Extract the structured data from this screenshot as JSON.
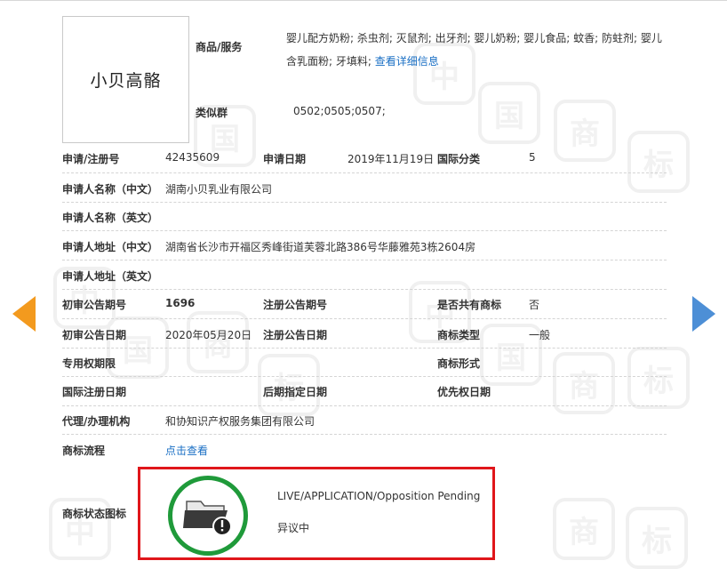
{
  "trademark": {
    "name": "小贝高骼",
    "goods_label": "商品/服务",
    "goods_text": "婴儿配方奶粉; 杀虫剂; 灭鼠剂; 出牙剂; 婴儿奶粉; 婴儿食品; 蚊香; 防蛀剂; 婴儿含乳面粉; 牙填料;",
    "goods_link": "查看详细信息",
    "similar_group_label": "类似群",
    "similar_group_value": "0502;0505;0507;"
  },
  "fields": {
    "reg_no_label": "申请/注册号",
    "reg_no_value": "42435609",
    "apply_date_label": "申请日期",
    "apply_date_value": "2019年11月19日",
    "intl_class_label": "国际分类",
    "intl_class_value": "5",
    "applicant_cn_label": "申请人名称（中文）",
    "applicant_cn_value": "湖南小贝乳业有限公司",
    "applicant_en_label": "申请人名称（英文）",
    "address_cn_label": "申请人地址（中文）",
    "address_cn_value": "湖南省长沙市开福区秀峰街道芙蓉北路386号华藤雅苑3栋2604房",
    "address_en_label": "申请人地址（英文）",
    "prelim_issue_label": "初审公告期号",
    "prelim_issue_value": "1696",
    "reg_issue_label": "注册公告期号",
    "shared_label": "是否共有商标",
    "shared_value": "否",
    "prelim_date_label": "初审公告日期",
    "prelim_date_value": "2020年05月20日",
    "reg_date_label": "注册公告日期",
    "tm_type_label": "商标类型",
    "tm_type_value": "一般",
    "exclusive_label": "专用权期限",
    "tm_form_label": "商标形式",
    "intl_reg_label": "国际注册日期",
    "later_date_label": "后期指定日期",
    "priority_label": "优先权日期",
    "agent_label": "代理/办理机构",
    "agent_value": "和协知识产权服务集团有限公司",
    "flow_label": "商标流程",
    "flow_link": "点击查看",
    "status_icon_label": "商标状态图标"
  },
  "status": {
    "en": "LIVE/APPLICATION/Opposition Pending",
    "cn": "异议中",
    "ring_color": "#1f9a3a",
    "box_color": "#e0161b"
  },
  "nav": {
    "prev_icon": "arrow-left-icon",
    "next_icon": "arrow-right-icon"
  }
}
